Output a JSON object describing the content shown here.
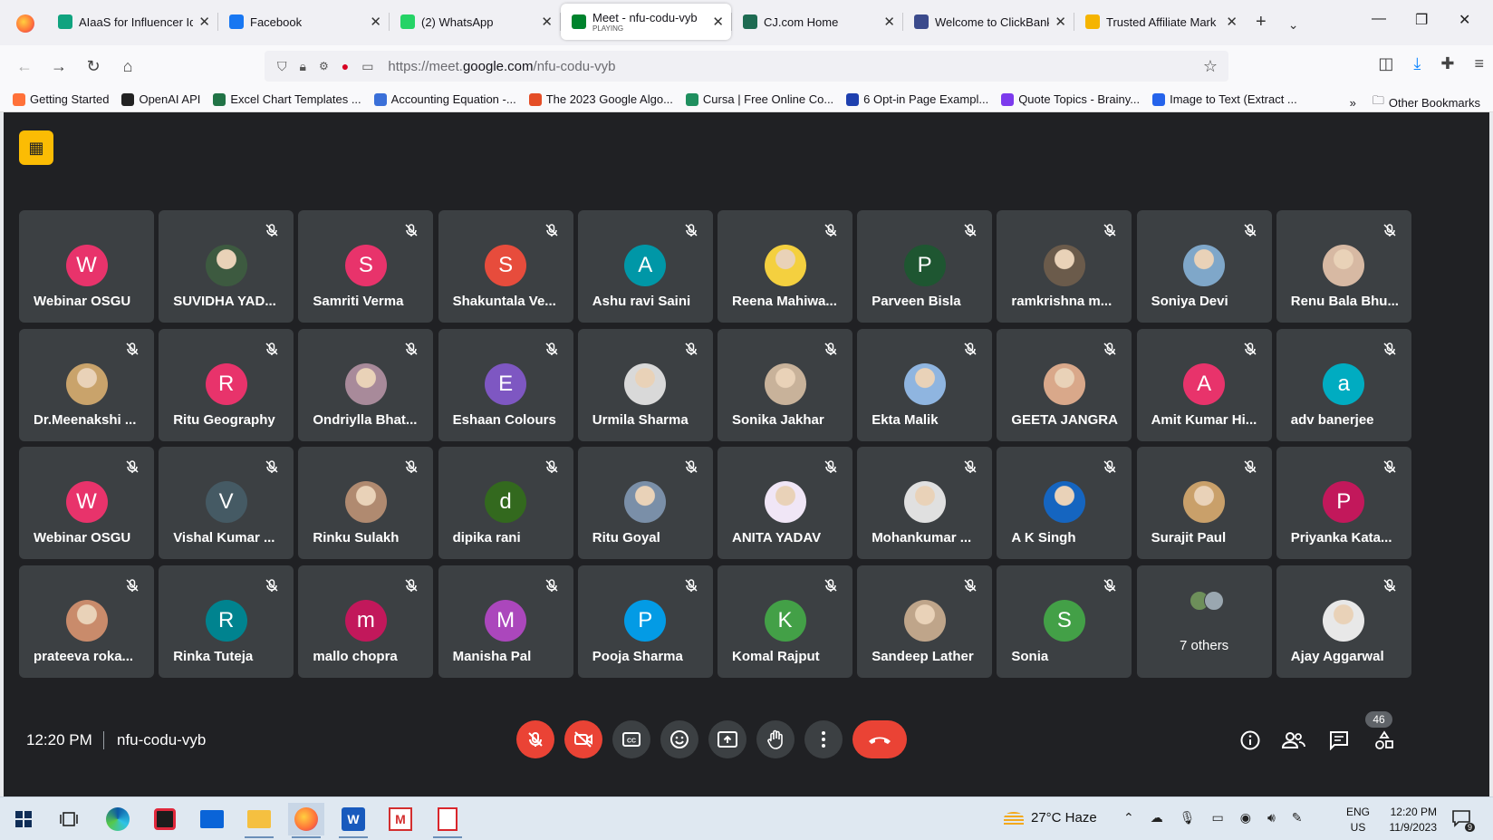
{
  "browser": {
    "tabs": [
      {
        "label": "AIaaS for Influencer Id",
        "favicon_color": "#10a37f",
        "active": false
      },
      {
        "label": "Facebook",
        "favicon_color": "#1877f2",
        "active": false
      },
      {
        "label": "(2) WhatsApp",
        "favicon_color": "#25d366",
        "active": false
      },
      {
        "label": "Meet - nfu-codu-vyb",
        "sub": "PLAYING",
        "favicon_color": "#00832d",
        "active": true
      },
      {
        "label": "CJ.com Home",
        "favicon_color": "#1e6b52",
        "active": false
      },
      {
        "label": "Welcome to ClickBank",
        "favicon_color": "#3b4a8c",
        "active": false
      },
      {
        "label": "Trusted Affiliate Mark",
        "favicon_color": "#f5b400",
        "active": false
      }
    ],
    "url_prefix": "https://meet.",
    "url_domain": "google.com",
    "url_path": "/nfu-codu-vyb",
    "bookmarks": [
      {
        "label": "Getting Started",
        "color": "#ff7139"
      },
      {
        "label": "OpenAI API",
        "color": "#222222"
      },
      {
        "label": "Excel Chart Templates ...",
        "color": "#217346"
      },
      {
        "label": "Accounting Equation -...",
        "color": "#3a6fd8"
      },
      {
        "label": "The 2023 Google Algo...",
        "color": "#e44d26"
      },
      {
        "label": "Cursa | Free Online Co...",
        "color": "#1f8f5f"
      },
      {
        "label": "6 Opt-in Page Exampl...",
        "color": "#1e40af"
      },
      {
        "label": "Quote Topics - Brainy...",
        "color": "#7c3aed"
      },
      {
        "label": "Image to Text (Extract ...",
        "color": "#2563eb"
      }
    ],
    "other_bookmarks": "Other Bookmarks"
  },
  "meet": {
    "participants": [
      {
        "name": "Webinar OSGU",
        "initial": "W",
        "color": "#e8336b",
        "muted": false
      },
      {
        "name": "SUVIDHA YAD...",
        "initial": "",
        "color": "#3d5a40",
        "muted": true
      },
      {
        "name": "Samriti Verma",
        "initial": "S",
        "color": "#e8336b",
        "muted": true
      },
      {
        "name": "Shakuntala Ve...",
        "initial": "S",
        "color": "#e74c3c",
        "muted": true
      },
      {
        "name": "Ashu ravi Saini",
        "initial": "A",
        "color": "#0097a7",
        "muted": true
      },
      {
        "name": "Reena Mahiwa...",
        "initial": "",
        "color": "#f4d03f",
        "muted": true
      },
      {
        "name": "Parveen Bisla",
        "initial": "P",
        "color": "#1e5631",
        "muted": true
      },
      {
        "name": "ramkrishna m...",
        "initial": "",
        "color": "#6b5b4b",
        "muted": true
      },
      {
        "name": "Soniya Devi",
        "initial": "",
        "color": "#7fa7c9",
        "muted": true
      },
      {
        "name": "Renu Bala Bhu...",
        "initial": "",
        "color": "#d7b9a3",
        "muted": true
      },
      {
        "name": "Dr.Meenakshi ...",
        "initial": "",
        "color": "#c9a36b",
        "muted": true
      },
      {
        "name": "Ritu Geography",
        "initial": "R",
        "color": "#e8336b",
        "muted": true
      },
      {
        "name": "Ondriylla Bhat...",
        "initial": "",
        "color": "#a88a9a",
        "muted": true
      },
      {
        "name": "Eshaan Colours",
        "initial": "E",
        "color": "#7e57c2",
        "muted": true
      },
      {
        "name": "Urmila Sharma",
        "initial": "",
        "color": "#d9d9d9",
        "muted": true
      },
      {
        "name": "Sonika Jakhar",
        "initial": "",
        "color": "#c8b29a",
        "muted": true
      },
      {
        "name": "Ekta Malik",
        "initial": "",
        "color": "#8fb5e0",
        "muted": true
      },
      {
        "name": "GEETA JANGRA",
        "initial": "",
        "color": "#d9a88a",
        "muted": true
      },
      {
        "name": "Amit Kumar Hi...",
        "initial": "A",
        "color": "#e8336b",
        "muted": true
      },
      {
        "name": "adv banerjee",
        "initial": "a",
        "color": "#00acc1",
        "muted": true
      },
      {
        "name": "Webinar OSGU",
        "initial": "W",
        "color": "#e8336b",
        "muted": true
      },
      {
        "name": "Vishal Kumar ...",
        "initial": "V",
        "color": "#455a64",
        "muted": true
      },
      {
        "name": "Rinku Sulakh",
        "initial": "",
        "color": "#b08a70",
        "muted": true
      },
      {
        "name": "dipika rani",
        "initial": "d",
        "color": "#33691e",
        "muted": true
      },
      {
        "name": "Ritu Goyal",
        "initial": "",
        "color": "#7a8fa8",
        "muted": true
      },
      {
        "name": "ANITA YADAV",
        "initial": "",
        "color": "#f0e6f6",
        "muted": true
      },
      {
        "name": "Mohankumar ...",
        "initial": "",
        "color": "#e0e0e0",
        "muted": true
      },
      {
        "name": "A K Singh",
        "initial": "",
        "color": "#1565c0",
        "muted": true
      },
      {
        "name": "Surajit Paul",
        "initial": "",
        "color": "#c9a06a",
        "muted": true
      },
      {
        "name": "Priyanka Kata...",
        "initial": "P",
        "color": "#c2185b",
        "muted": true
      },
      {
        "name": "prateeva roka...",
        "initial": "",
        "color": "#c98b6b",
        "muted": true
      },
      {
        "name": "Rinka Tuteja",
        "initial": "R",
        "color": "#00838f",
        "muted": true
      },
      {
        "name": "mallo chopra",
        "initial": "m",
        "color": "#c2185b",
        "muted": true
      },
      {
        "name": "Manisha Pal",
        "initial": "M",
        "color": "#ab47bc",
        "muted": true
      },
      {
        "name": "Pooja Sharma",
        "initial": "P",
        "color": "#039be5",
        "muted": true
      },
      {
        "name": "Komal Rajput",
        "initial": "K",
        "color": "#43a047",
        "muted": true
      },
      {
        "name": "Sandeep Lather",
        "initial": "",
        "color": "#bfa58a",
        "muted": true
      },
      {
        "name": "Sonia",
        "initial": "S",
        "color": "#43a047",
        "muted": true
      },
      {
        "name": "7 others",
        "initial": "",
        "color": "#6d8f5a",
        "muted": false,
        "others": true
      },
      {
        "name": "Ajay Aggarwal",
        "initial": "",
        "color": "#e8e8e8",
        "muted": true
      }
    ],
    "clock": "12:20 PM",
    "meeting_code": "nfu-codu-vyb",
    "people_count": "46"
  },
  "taskbar": {
    "weather": "27°C  Haze",
    "lang_top": "ENG",
    "lang_bottom": "US",
    "time": "12:20 PM",
    "date": "11/9/2023",
    "notif_count": "9"
  }
}
